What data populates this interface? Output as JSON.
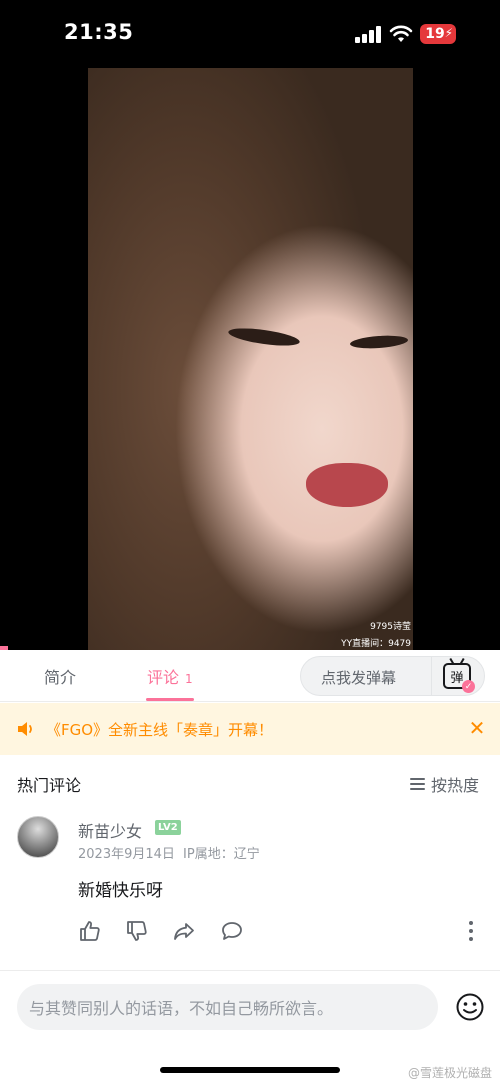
{
  "status_bar": {
    "time": "21:35",
    "battery": "19"
  },
  "video": {
    "overlay_name": "9795诗莹",
    "overlay_room": "YY直播间：9479"
  },
  "tabs": {
    "intro_label": "简介",
    "comments_label": "评论",
    "comments_count": "1",
    "danmaku_placeholder": "点我发弹幕",
    "danmaku_toggle_label": "弹"
  },
  "notice": {
    "text": "《FGO》全新主线「奏章」开幕！"
  },
  "comments_section": {
    "title": "热门评论",
    "sort_label": "按热度"
  },
  "comment": {
    "username": "新苗少女",
    "level": "LV2",
    "date": "2023年9月14日",
    "ip_location": "IP属地：辽宁",
    "text": "新婚快乐呀"
  },
  "reply": {
    "placeholder": "与其赞同别人的话语，不如自己畅所欲言。"
  },
  "watermark": "@雪莲极光磁盘",
  "colors": {
    "accent": "#fb7299",
    "notice_bg": "#fff6e0",
    "notice_text": "#ff8c00"
  }
}
